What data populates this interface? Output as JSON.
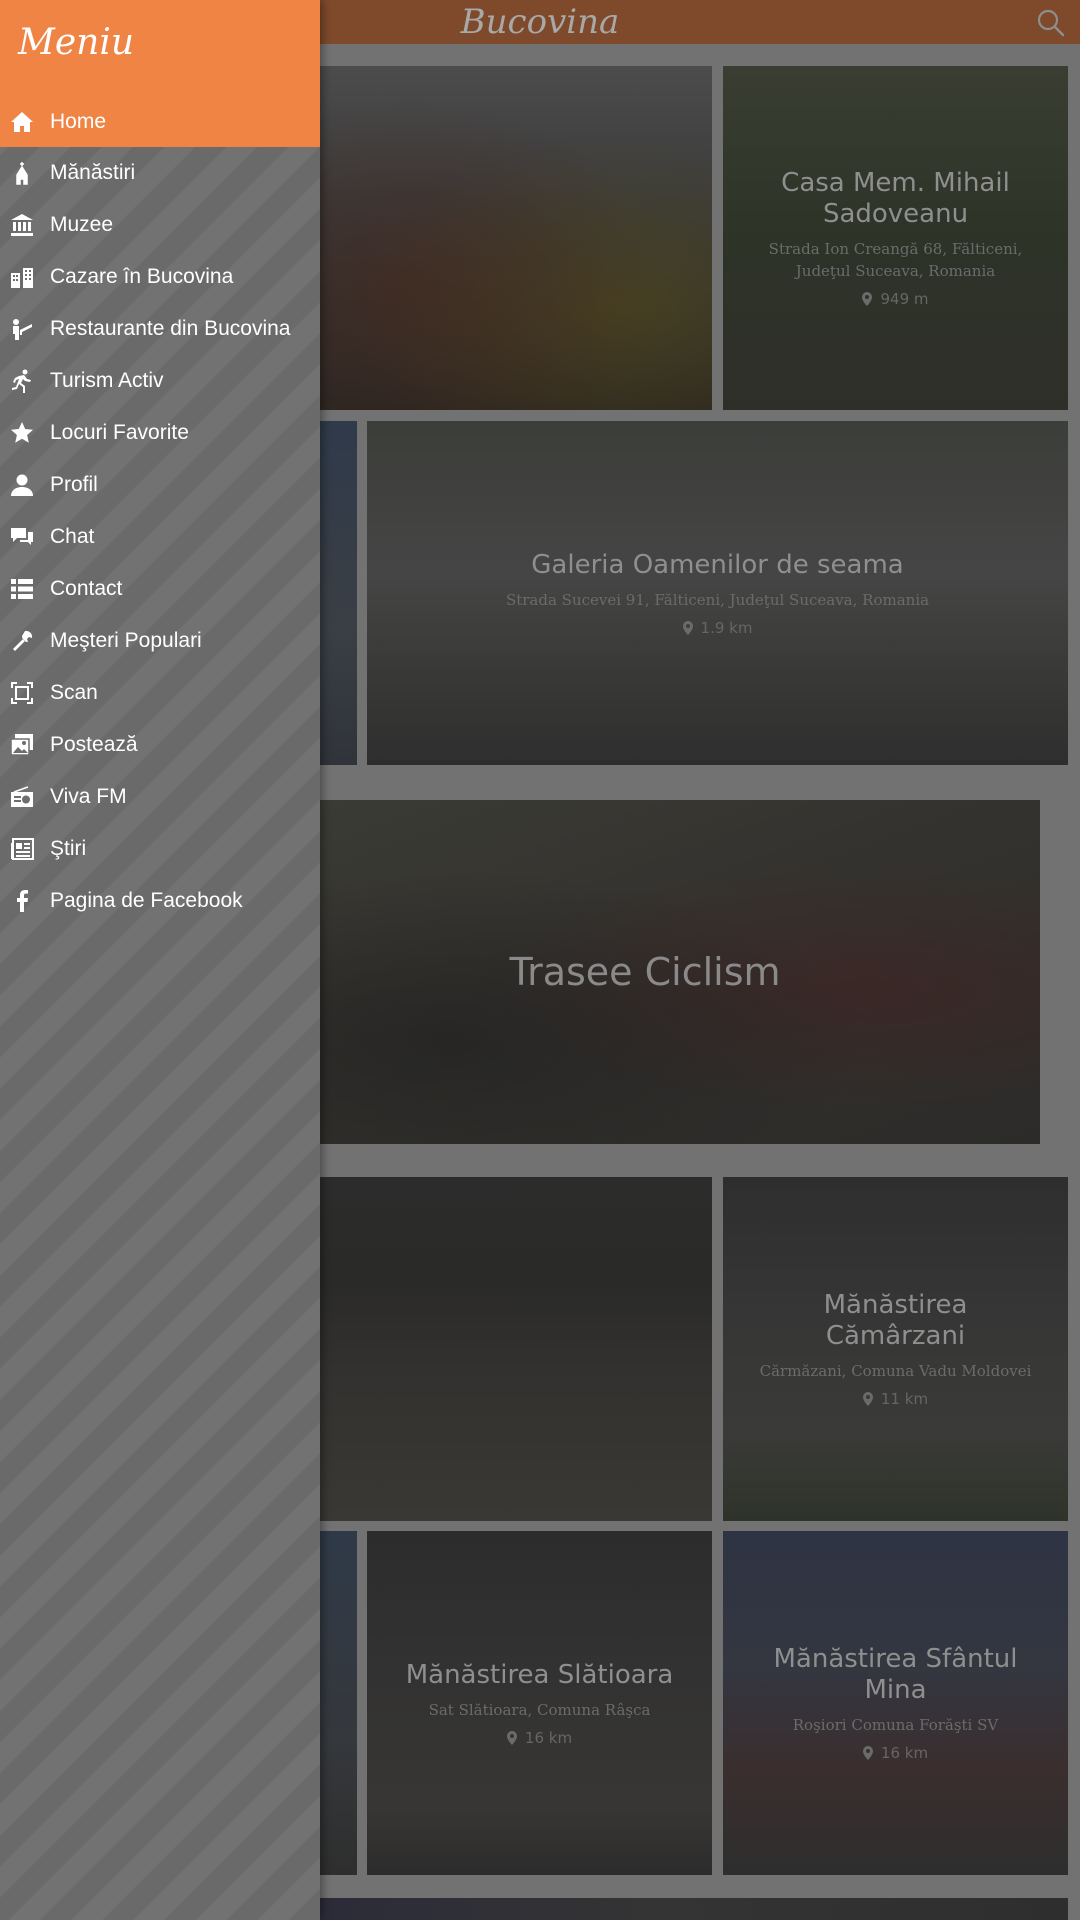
{
  "header": {
    "title": "Bucovina"
  },
  "drawer": {
    "title": "Meniu",
    "items": [
      {
        "label": "Home",
        "icon": "home-icon",
        "active": true
      },
      {
        "label": "Mănăstiri",
        "icon": "monastery-icon"
      },
      {
        "label": "Muzee",
        "icon": "museum-icon"
      },
      {
        "label": "Cazare în Bucovina",
        "icon": "hotel-icon"
      },
      {
        "label": "Restaurante din Bucovina",
        "icon": "restaurant-icon"
      },
      {
        "label": "Turism Activ",
        "icon": "running-icon"
      },
      {
        "label": "Locuri Favorite",
        "icon": "star-icon"
      },
      {
        "label": "Profil",
        "icon": "user-icon"
      },
      {
        "label": "Chat",
        "icon": "chat-icon"
      },
      {
        "label": "Contact",
        "icon": "list-icon"
      },
      {
        "label": "Meşteri Populari",
        "icon": "tools-icon"
      },
      {
        "label": "Scan",
        "icon": "scan-icon"
      },
      {
        "label": "Postează",
        "icon": "post-photo-icon"
      },
      {
        "label": "Viva FM",
        "icon": "radio-icon"
      },
      {
        "label": "Ştiri",
        "icon": "news-icon"
      },
      {
        "label": "Pagina de Facebook",
        "icon": "facebook-icon"
      }
    ]
  },
  "cards": {
    "sadoveanu": {
      "title": "Casa Mem. Mihail Sadoveanu",
      "address": "Strada Ion Creangă 68, Fălticeni, Judeţul Suceava, Romania",
      "distance": "949 m"
    },
    "galeria": {
      "title": "Galeria Oamenilor de seama",
      "address": "Strada Sucevei 91, Fălticeni, Judeţul Suceava, Romania",
      "distance": "1.9 km"
    },
    "ciclism": {
      "title": "Trasee Ciclism"
    },
    "camarzani": {
      "title": "Mănăstirea Cămârzani",
      "address": "Cărmăzani, Comuna Vadu Moldovei",
      "distance": "11 km"
    },
    "slatioara": {
      "title": "Mănăstirea Slătioara",
      "address": "Sat Slătioara, Comuna Râşca",
      "distance": "16 km"
    },
    "mina": {
      "title": "Mănăstirea Sfântul Mina",
      "address": "Roşiori Comuna Forăşti SV",
      "distance": "16 km"
    }
  },
  "colors": {
    "accent": "#ef8445",
    "topbar": "#7e4a2b",
    "drawer": "#6e6e6e"
  }
}
